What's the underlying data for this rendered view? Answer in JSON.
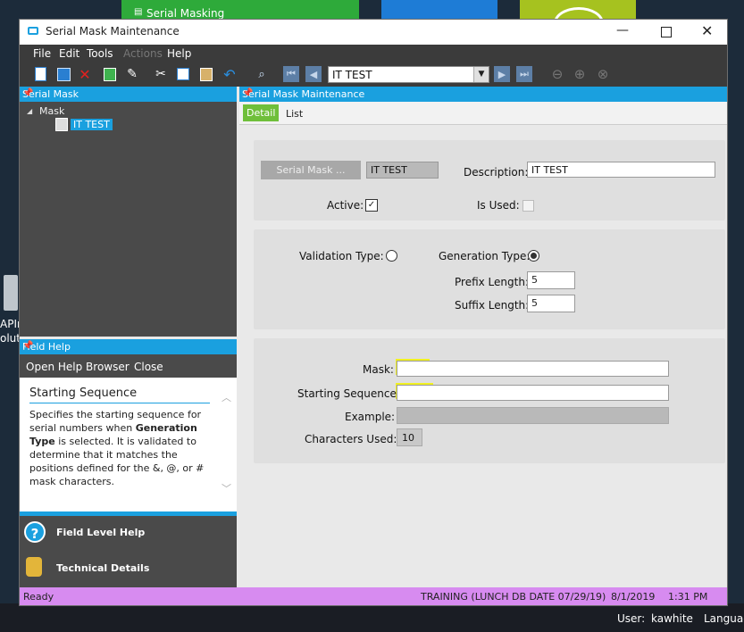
{
  "desktop": {
    "top_tile_label": "Serial Masking",
    "side_text_1": "APIn",
    "side_text_2": "olut",
    "user_label": "User:",
    "user_name": "kawhite",
    "language_label": "Languag"
  },
  "window": {
    "title": "Serial Mask Maintenance",
    "colors": {
      "accent": "#1aa0df",
      "status": "#d78bf0",
      "dark": "#3b3b3b",
      "tab_active": "#6fbf3a"
    }
  },
  "menu": {
    "file": "File",
    "edit": "Edit",
    "tools": "Tools",
    "actions": "Actions",
    "help": "Help"
  },
  "toolbar": {
    "record_value": "IT TEST",
    "icons": [
      "new-icon",
      "save-icon",
      "delete-icon",
      "refresh-icon",
      "clear-icon",
      "cut-icon",
      "copy-icon",
      "paste-icon",
      "undo-icon",
      "search-icon",
      "first-icon",
      "prev-icon",
      "next-icon",
      "last-icon",
      "back-icon",
      "forward-icon",
      "stop-icon"
    ]
  },
  "left_tree": {
    "header": "Serial Mask",
    "root_label": "Mask",
    "child_label": "IT TEST"
  },
  "field_help": {
    "header": "Field Help",
    "open_browser": "Open Help Browser",
    "close": "Close",
    "topic_title": "Starting Sequence",
    "body_1": "Specifies the starting sequence for serial numbers when ",
    "body_bold": "Generation Type",
    "body_2": " is selected. It is validated to determine that it matches the positions defined for the &, @, or # mask characters.",
    "field_level_help": "Field Level Help",
    "technical_details": "Technical Details"
  },
  "main": {
    "header": "Serial Mask Maintenance",
    "tabs": {
      "detail": "Detail",
      "list": "List"
    },
    "serial_mask_button": "Serial Mask ...",
    "serial_mask_value": "IT TEST",
    "description_label": "Description:",
    "description_value": "IT TEST",
    "active_label": "Active:",
    "is_used_label": "Is Used:",
    "validation_type_label": "Validation Type:",
    "generation_type_label": "Generation Type:",
    "prefix_length_label": "Prefix Length:",
    "prefix_length_value": "5",
    "suffix_length_label": "Suffix Length:",
    "suffix_length_value": "5",
    "mask_label": "Mask:",
    "mask_value": "",
    "starting_sequence_label": "Starting Sequence:",
    "starting_sequence_value": "",
    "example_label": "Example:",
    "characters_used_label": "Characters Used:",
    "characters_used_value": "10"
  },
  "status": {
    "ready": "Ready",
    "environment": "TRAINING (LUNCH DB DATE 07/29/19)",
    "date": "8/1/2019",
    "time": "1:31 PM"
  }
}
